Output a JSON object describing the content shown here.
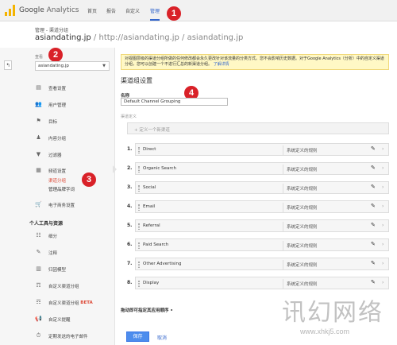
{
  "app": {
    "name_prefix": "Google",
    "name_suffix": "Analytics"
  },
  "nav": {
    "items": [
      {
        "label": "首页",
        "active": false
      },
      {
        "label": "报告",
        "active": false
      },
      {
        "label": "自定义",
        "active": false
      },
      {
        "label": "管理",
        "active": true
      }
    ]
  },
  "breadcrumb": "管理 - 渠道分组",
  "property": {
    "name": "asiandating.jp",
    "url_part": " / http://asiandating.jp / asiandating.jp"
  },
  "view": {
    "label": "查看",
    "selected": "asiandating.jp",
    "back_arrow": "↰"
  },
  "sidebar": {
    "items": [
      {
        "label": "查看设置",
        "icon": "document-icon"
      },
      {
        "label": "用户管理",
        "icon": "users-icon"
      },
      {
        "label": "目标",
        "icon": "flag-icon"
      },
      {
        "label": "内容分组",
        "icon": "person-icon"
      },
      {
        "label": "过滤器",
        "icon": "filter-icon"
      },
      {
        "label": "频道设置",
        "icon": "channel-icon"
      },
      {
        "label": "电子商务设置",
        "icon": "cart-icon"
      }
    ],
    "channel_sub": [
      {
        "label": "渠道分组",
        "active": true
      },
      {
        "label": "管理品牌字词",
        "active": false
      }
    ],
    "personal_heading": "个人工具与资源",
    "personal_items": [
      {
        "label": "细分",
        "icon": "segments-icon"
      },
      {
        "label": "注释",
        "icon": "annotation-icon"
      },
      {
        "label": "归因模型",
        "icon": "attribution-icon"
      },
      {
        "label": "自定义渠道分组",
        "icon": "custom-channel-icon"
      },
      {
        "label": "自定义渠道分组",
        "beta": "BETA",
        "icon": "custom-channel-beta-icon"
      },
      {
        "label": "自定义提醒",
        "icon": "alert-icon"
      },
      {
        "label": "定期发送的电子邮件",
        "icon": "email-icon"
      }
    ]
  },
  "notice": {
    "text": "对视图层级的渠道分组所做的任何修改都会永久更改针对该流量的分类方式。您不会影响历史数据。对于Google Analytics（分析）中的自定义渠道分组，您可以创建一个不进行汇总的新渠道分组。",
    "link": "了解详情"
  },
  "main": {
    "title": "渠道组设置",
    "name_label": "名称",
    "name_value": "Default Channel Grouping",
    "definition_label": "渠道定义",
    "add_placeholder": "+    定义一个新渠道",
    "drag_hint": "拖动即可指定其应用顺序 •",
    "save": "保存",
    "cancel": "取消"
  },
  "channels": [
    {
      "num": "1.",
      "name": "Direct",
      "rule": "系统定义的规则"
    },
    {
      "num": "2.",
      "name": "Organic Search",
      "rule": "系统定义的规则"
    },
    {
      "num": "3.",
      "name": "Social",
      "rule": "系统定义的规则"
    },
    {
      "num": "4.",
      "name": "Email",
      "rule": "系统定义的规则"
    },
    {
      "num": "5.",
      "name": "Referral",
      "rule": "系统定义的规则"
    },
    {
      "num": "6.",
      "name": "Paid Search",
      "rule": "系统定义的规则"
    },
    {
      "num": "7.",
      "name": "Other Advertising",
      "rule": "系统定义的规则"
    },
    {
      "num": "8.",
      "name": "Display",
      "rule": "系统定义的规则"
    }
  ],
  "annotations": [
    "1",
    "2",
    "3",
    "4"
  ],
  "watermark": {
    "text": "讯幻网络",
    "url": "www.xhkj5.com"
  },
  "colors": {
    "accent": "#3366cc",
    "badge": "#d92128",
    "save": "#4d8ded",
    "notice_bg": "#fff8c5",
    "active_sub": "#dd4b39"
  }
}
